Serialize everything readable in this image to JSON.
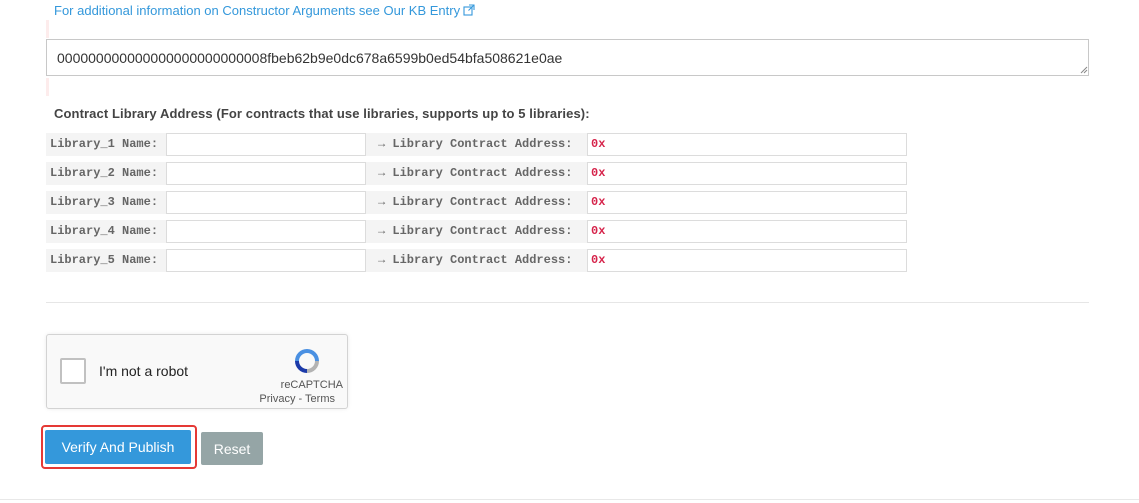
{
  "constructor": {
    "kb_link_text": "For additional information on Constructor Arguments see Our KB Entry",
    "value": "000000000000000000000000008fbeb62b9e0dc678a6599b0ed54bfa508621e0ae"
  },
  "libraries": {
    "heading": "Contract Library Address (For contracts that use libraries, supports up to 5 libraries):",
    "address_label": "→ Library Contract Address:",
    "rows": [
      {
        "name_label": "Library_1 Name:",
        "name_value": "",
        "address_value": "0x"
      },
      {
        "name_label": "Library_2 Name:",
        "name_value": "",
        "address_value": "0x"
      },
      {
        "name_label": "Library_3 Name:",
        "name_value": "",
        "address_value": "0x"
      },
      {
        "name_label": "Library_4 Name:",
        "name_value": "",
        "address_value": "0x"
      },
      {
        "name_label": "Library_5 Name:",
        "name_value": "",
        "address_value": "0x"
      }
    ]
  },
  "recaptcha": {
    "label": "I'm not a robot",
    "brand": "reCAPTCHA",
    "privacy": "Privacy",
    "separator": " - ",
    "terms": "Terms"
  },
  "actions": {
    "verify_label": "Verify And Publish",
    "reset_label": "Reset"
  },
  "colors": {
    "accent": "#3498db",
    "reset": "#95a5a6",
    "highlight": "#e53935",
    "address_prefix": "#d6244b"
  },
  "icons": {
    "kb_link": "external-link-icon",
    "recaptcha": "recaptcha-logo-icon",
    "grip": "resize-grip-icon"
  }
}
